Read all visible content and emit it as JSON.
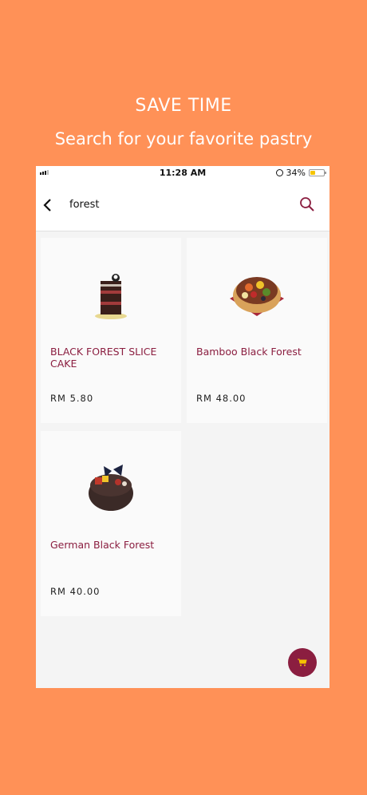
{
  "promo": {
    "title": "SAVE TIME",
    "subtitle": "Search for your favorite pastry"
  },
  "status_bar": {
    "time": "11:28 AM",
    "battery": "34%",
    "battery_level": 0.34
  },
  "search": {
    "query": "forest",
    "back_icon": "chevron-left-icon",
    "search_icon": "search-icon"
  },
  "products": [
    {
      "name": "BLACK FOREST SLICE CAKE",
      "price": "RM 5.80",
      "image": "cake-slice"
    },
    {
      "name": "Bamboo Black Forest",
      "price": "RM 48.00",
      "image": "fruit-cake"
    },
    {
      "name": "German Black Forest",
      "price": "RM 40.00",
      "image": "chocolate-cake"
    }
  ],
  "cart_button": {
    "icon": "cart-icon"
  },
  "colors": {
    "background": "#FF9157",
    "accent": "#8B1E40"
  }
}
